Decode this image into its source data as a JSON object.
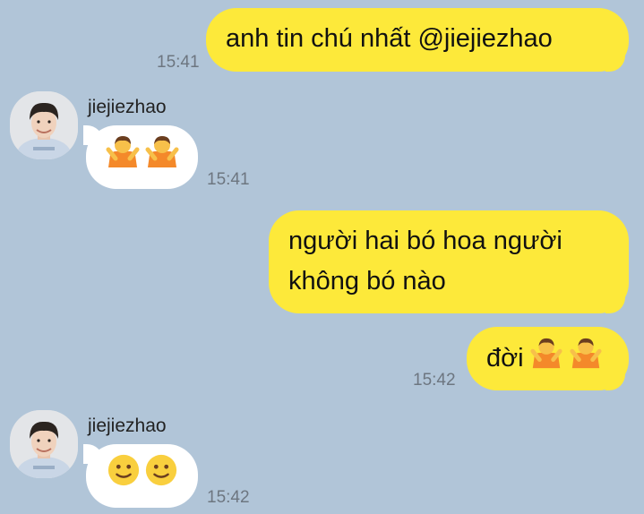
{
  "messages": [
    {
      "text": "anh tin chú nhất @jiejiezhao",
      "time": "15:41"
    },
    {
      "sender": "jiejiezhao",
      "emoji": [
        "person-gesturing-no-icon",
        "person-gesturing-no-icon"
      ],
      "time": "15:41"
    },
    {
      "lines": [
        "người hai bó hoa người",
        "không bó nào"
      ]
    },
    {
      "text": "đời",
      "emoji": [
        "person-gesturing-no-icon",
        "person-gesturing-no-icon"
      ],
      "time": "15:42"
    },
    {
      "sender": "jiejiezhao",
      "emoji": [
        "slightly-smiling-face-icon",
        "slightly-smiling-face-icon"
      ],
      "time": "15:42"
    }
  ],
  "colors": {
    "background": "#b1c5d8",
    "outgoing_bubble": "#fde93a",
    "incoming_bubble": "#ffffff",
    "timestamp": "#6d7680"
  }
}
